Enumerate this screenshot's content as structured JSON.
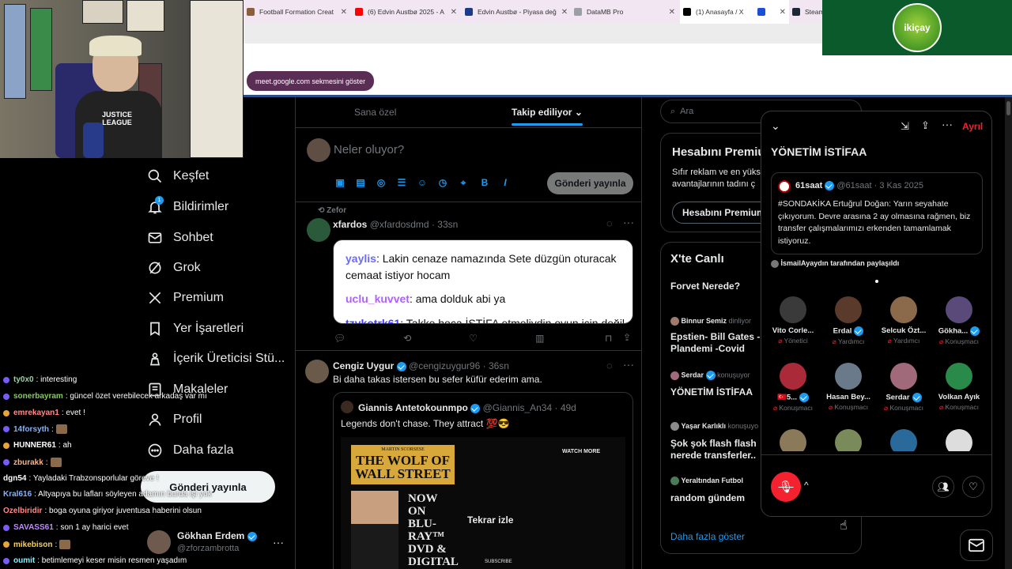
{
  "browser": {
    "tabs": [
      {
        "label": "Football Formation Creat",
        "fav_color": "#8b5e3c"
      },
      {
        "label": "(6) Edvin Austbø 2025 - A",
        "fav_color": "#ff0000"
      },
      {
        "label": "Edvin Austbø - Piyasa değ",
        "fav_color": "#1a3a8a"
      },
      {
        "label": "DataMB Pro",
        "fav_color": "#9aa0a6"
      },
      {
        "label": "(1) Anasayfa / X",
        "fav_color": "#000000"
      },
      {
        "label": "",
        "fav_color": "#1d4ed8"
      },
      {
        "label": "Steam",
        "fav_color": "#1b2838"
      }
    ],
    "meet_popup": "meet.google.com sekmesini göster"
  },
  "sponsor": {
    "logo_text": "ikiçay"
  },
  "webcam": {
    "shirt_text": "JUSTICE LEAGUE"
  },
  "nav": {
    "items": [
      {
        "label": "Keşfet",
        "icon": "search-icon"
      },
      {
        "label": "Bildirimler",
        "icon": "bell-icon",
        "badge": "1"
      },
      {
        "label": "Sohbet",
        "icon": "mail-icon"
      },
      {
        "label": "Grok",
        "icon": "grok-icon"
      },
      {
        "label": "Premium",
        "icon": "x-logo-icon"
      },
      {
        "label": "Yer İşaretleri",
        "icon": "bookmark-icon"
      },
      {
        "label": "İçerik Üreticisi Stü...",
        "icon": "creator-icon"
      },
      {
        "label": "Makaleler",
        "icon": "article-icon"
      },
      {
        "label": "Profil",
        "icon": "profile-icon"
      },
      {
        "label": "Daha fazla",
        "icon": "more-circle-icon"
      }
    ],
    "post_button": "Gönderi yayınla",
    "profile": {
      "name": "Gökhan Erdem",
      "handle": "@zforzambrotta"
    }
  },
  "chat": [
    {
      "user": "ty0x0",
      "msg": ": interesting",
      "color": "#9ad0a8",
      "badge": "#7a5af8"
    },
    {
      "user": "sonerbayram",
      "msg": ": güncel özet verebilecek arkadaş var mı",
      "color": "#7fd34e",
      "badge": "#7a5af8"
    },
    {
      "user": "emrekayan1",
      "msg": ": evet !",
      "color": "#ff8a8a",
      "badge": "#e8a33b"
    },
    {
      "user": "14forsyth",
      "msg": ":",
      "color": "#7fb3ff",
      "badge": "#7a5af8",
      "emote": true
    },
    {
      "user": "HUNNER61",
      "msg": ": ah",
      "color": "#ffffff",
      "badge": "#e8a33b"
    },
    {
      "user": "zburakk",
      "msg": ":",
      "color": "#ffb37f",
      "badge": "#7a5af8",
      "emote": true
    },
    {
      "user": "dgn54",
      "msg": ": Yayladaki Trabzonsporlular göreve !",
      "color": "#ffffff",
      "badge": ""
    },
    {
      "user": "Kral616",
      "msg": ": Altyapıya bu lafları söyleyen adamın burda işi yok",
      "color": "#7fb3ff",
      "badge": ""
    },
    {
      "user": "Ozelbiridir",
      "msg": ": boga oyuna giriyor juventusa haberini olsun",
      "color": "#ff8a8a",
      "badge": ""
    },
    {
      "user": "SAVASS61",
      "msg": ": son 1 ay harici evet",
      "color": "#c08aff",
      "badge": "#7a5af8"
    },
    {
      "user": "mikebison",
      "msg": ":",
      "color": "#ffd24a",
      "badge": "#e8a33b",
      "emote": true
    },
    {
      "user": "oumit",
      "msg": ": betimlemeyi keser misin resmen yaşadım",
      "color": "#7ff0ff",
      "badge": "#7a5af8"
    }
  ],
  "feed": {
    "tabs": [
      "Sana özel",
      "Takip ediliyor"
    ],
    "composer_placeholder": "Neler oluyor?",
    "post_button": "Gönderi yayınla",
    "tweet1": {
      "repost_by": "Zefor",
      "name": "xfardos",
      "handle": "@xfardosdmd",
      "time": "33sn",
      "lines": [
        {
          "user": "yaylis",
          "text": ": Lakin cenaze namazında Sete düzgün oturacak cemaat istiyor hocam",
          "color": "#6a6aff"
        },
        {
          "user": "uclu_kuvvet",
          "text": ": ama dolduk abi ya",
          "color": "#b060ff"
        },
        {
          "user": "tzykotrk61",
          "text": ": Takke hoca İSTİFA etmeliydin oyun için değil",
          "color": "#4040ff"
        }
      ]
    },
    "tweet2": {
      "name": "Cengiz Uygur",
      "handle": "@cengizuygur96",
      "time": "36sn",
      "text": "Bi daha takas istersen bu sefer küfür ederim ama.",
      "quote": {
        "name": "Giannis Antetokounmpo",
        "handle": "@Giannis_An34",
        "time": "49d",
        "text": "Legends don't chase. They attract 💯😎",
        "poster_top": "MARTIN SCORSESE",
        "poster_title": "THE WOLF OF WALL STREET",
        "poster_bottom": "NOW ON BLU-RAY™ DVD & DIGITAL",
        "watch_more": "WATCH MORE",
        "subscribe": "SUBSCRIBE",
        "replay": "Tekrar izle"
      }
    }
  },
  "right": {
    "search_placeholder": "Ara",
    "premium_title": "Hesabını Premiu",
    "premium_text": "Sıfır reklam ve en yüks avantajlarının tadını ç",
    "premium_button": "Hesabını Premium",
    "live_title": "X'te Canlı",
    "live_items": [
      {
        "host": "",
        "status": "",
        "title": "Forvet Nerede?"
      },
      {
        "host": "Binnur Semiz",
        "status": "dinliyor",
        "title": "Epstien- Bill Gates - Plandemi -Covid Aşıla"
      },
      {
        "host": "Serdar",
        "status": "konuşuyor",
        "title": "YÖNETİM İSTİFAA"
      },
      {
        "host": "Yaşar Karlıklı",
        "status": "konuşuyo",
        "title": "Şok şok flash flash nerede transferler.."
      },
      {
        "host": "Yeraltından Futbol",
        "status": "",
        "title": "random gündem"
      }
    ],
    "show_more": "Daha fazla göster"
  },
  "space": {
    "leave": "Ayrıl",
    "title": "YÖNETİM İSTİFAA",
    "pinned": {
      "name": "61saat",
      "handle": "@61saat",
      "date": "3 Kas 2025",
      "text": "#SONDAKİKA Ertuğrul Doğan: Yarın seyahate çıkıyorum. Devre arasına 2 ay olmasına rağmen, biz transfer çalışmalarımızı erkenden tamamlamak istiyoruz."
    },
    "shared_by": "İsmailAyaydın tarafından paylaşıldı",
    "participants": [
      {
        "name": "Vito Corle...",
        "role": "Yönetici",
        "color": "#3a3a3a",
        "verified": false
      },
      {
        "name": "Erdal",
        "role": "Yardımcı",
        "color": "#5a3a2a",
        "verified": true
      },
      {
        "name": "Selcuk Özt...",
        "role": "Yardımcı",
        "color": "#8a6a4a",
        "verified": false
      },
      {
        "name": "Gökha...",
        "role": "Konuşmacı",
        "color": "#5a4a7a",
        "verified": true
      },
      {
        "name": "🇹🇷5...",
        "role": "Konuşmacı",
        "color": "#aa2a3a",
        "verified": true
      },
      {
        "name": "Hasan Bey...",
        "role": "Konuşmacı",
        "color": "#6a7a8a",
        "verified": false
      },
      {
        "name": "Serdar",
        "role": "Konuşmacı",
        "color": "#a06a7a",
        "verified": true
      },
      {
        "name": "Volkan Ayık",
        "role": "Konuşmacı",
        "color": "#2a8a4a",
        "verified": false
      },
      {
        "name": "",
        "role": "",
        "color": "#8a7a5a",
        "verified": false
      },
      {
        "name": "",
        "role": "",
        "color": "#7a8a5a",
        "verified": false
      },
      {
        "name": "",
        "role": "",
        "color": "#2a6a9a",
        "verified": false
      },
      {
        "name": "",
        "role": "",
        "color": "#dddddd",
        "verified": false
      }
    ]
  },
  "colors": {
    "accent": "#1d9bf0",
    "leave": "#f4212e",
    "mic": "#f4212e"
  }
}
